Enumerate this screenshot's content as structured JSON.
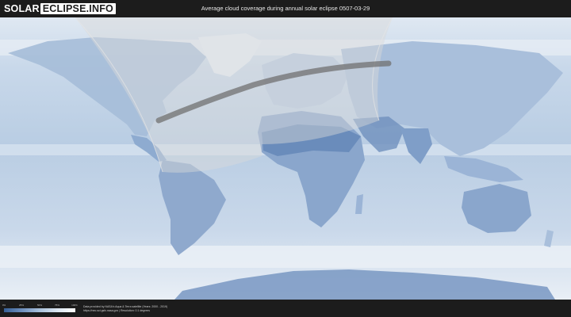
{
  "header": {
    "logo_part1": "SOLAR",
    "logo_part2": "ECLIPSE.INFO",
    "title": "Average cloud coverage during annual solar eclipse 0507-03-29"
  },
  "legend": {
    "scale_colors": [
      "#365f95",
      "#6d8fbd",
      "#a9c1dc",
      "#dbe6f1",
      "#ffffff"
    ],
    "ticks": [
      "0%",
      "25%",
      "50%",
      "75%",
      "100%"
    ]
  },
  "footer": {
    "credit_line1": "Data provided by NASA's Aqua & Terra satellite (Years: 2000 - 2019)",
    "credit_line2": "https://neo.sci.gsfc.nasa.gov | Resolution: 0.1 degrees"
  },
  "map": {
    "ocean_color": "#bdd0e4",
    "land_color": "#8aa6cc",
    "eclipse_path_color": "#707070",
    "visibility_shade_color": "#d9d9d9"
  }
}
